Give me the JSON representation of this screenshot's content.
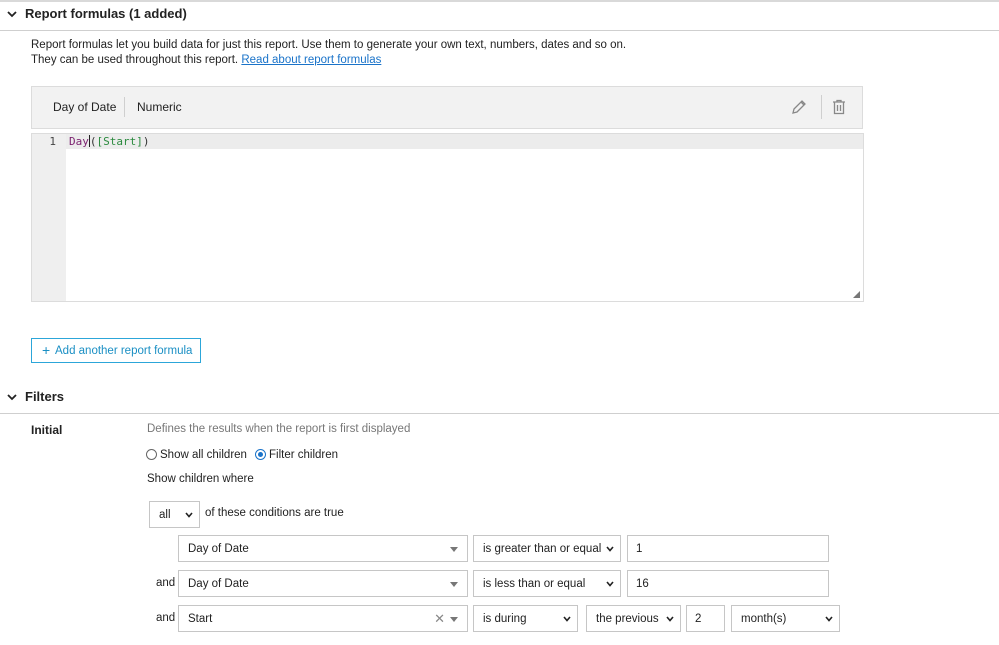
{
  "report_formulas": {
    "title": "Report formulas (1 added)",
    "intro_line1": "Report formulas let you build data for just this report. Use them to generate your own text, numbers, dates and so on.",
    "intro_line2": "They can be used throughout this report.",
    "link_text": "Read about report formulas",
    "formula": {
      "name": "Day of Date",
      "type": "Numeric",
      "line_number": "1",
      "code_fn": "Day",
      "code_open": "(",
      "code_ref": "[Start]",
      "code_close": ")"
    },
    "add_button_label": "Add another report formula"
  },
  "filters": {
    "title": "Filters",
    "initial_label": "Initial",
    "hint": "Defines the results when the report is first displayed",
    "radio_all": "Show all children",
    "radio_filter": "Filter children",
    "selected_radio": "filter",
    "show_where": "Show children where",
    "match_value": "all",
    "match_suffix": "of these conditions are true",
    "conditions": [
      {
        "conj": "",
        "field": "Day of Date",
        "operator": "is greater than or equal",
        "value": "1"
      },
      {
        "conj": "and",
        "field": "Day of Date",
        "operator": "is less than or equal",
        "value": "16"
      },
      {
        "conj": "and",
        "field": "Start",
        "operator": "is during",
        "period": "the previous",
        "value": "2",
        "unit": "month(s)"
      }
    ]
  },
  "colors": {
    "accent": "#1a73c9",
    "button_border": "#2ca6d9"
  }
}
